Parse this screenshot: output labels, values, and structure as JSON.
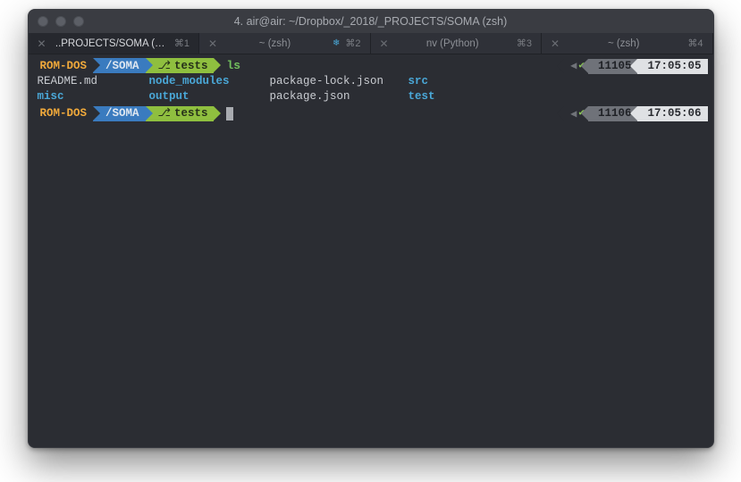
{
  "window": {
    "title": "4. air@air: ~/Dropbox/_2018/_PROJECTS/SOMA (zsh)"
  },
  "tabs": [
    {
      "label": "..PROJECTS/SOMA (…",
      "shortcut": "⌘1",
      "active": true,
      "icon": ""
    },
    {
      "label": "~ (zsh)",
      "shortcut": "⌘2",
      "active": false,
      "icon": "dot"
    },
    {
      "label": "nv (Python)",
      "shortcut": "⌘3",
      "active": false,
      "icon": ""
    },
    {
      "label": "~ (zsh)",
      "shortcut": "⌘4",
      "active": false,
      "icon": ""
    }
  ],
  "prompts": [
    {
      "machine": "ROM-DOS",
      "path": "/SOMA",
      "branch": "tests",
      "command": "ls",
      "history_num": "11105",
      "time": "17:05:05"
    },
    {
      "machine": "ROM-DOS",
      "path": "/SOMA",
      "branch": "tests",
      "command": "",
      "history_num": "11106",
      "time": "17:05:06"
    }
  ],
  "ls": {
    "r0": {
      "c0": "README.md",
      "c1": "node_modules",
      "c2": "package-lock.json",
      "c3": "src"
    },
    "r1": {
      "c0": "misc",
      "c1": "output",
      "c2": "package.json",
      "c3": "test"
    }
  },
  "glyphs": {
    "close": "✕",
    "branch": "⎇",
    "triangle": "◀",
    "check": "✔",
    "dot": "❄"
  }
}
